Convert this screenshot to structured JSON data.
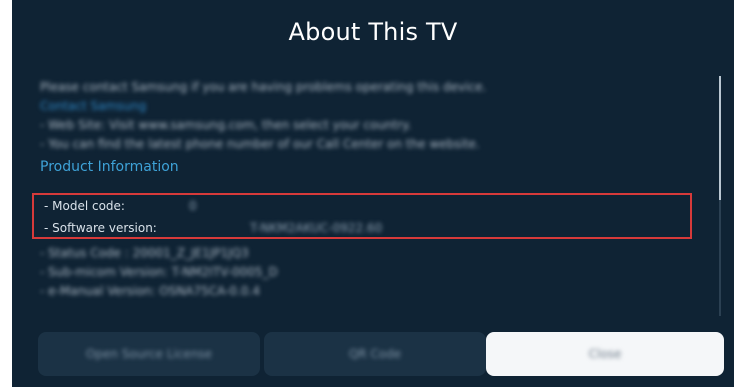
{
  "dialog": {
    "title": "About This TV"
  },
  "intro": {
    "contact_text": "Please contact Samsung if you are having problems operating this device.",
    "contact_link": "Contact Samsung",
    "website_line": " - Web Site: Visit www.samsung.com, then select your country.",
    "phone_line": " - You can find the latest phone number of our Call Center on the website."
  },
  "product_info": {
    "header": "Product Information",
    "model_label": " - Model code:",
    "model_value": "0",
    "software_label": " - Software version:",
    "software_value": "T-NKM2AKUC-0922.60"
  },
  "more_info": [
    " - Status Code : 20001_Z_JE1JP1JQ3",
    " - Sub-micom Version: T-NM2ITV-0005_D",
    " - e-Manual Version: OSNA75CA-0.0.4"
  ],
  "buttons": {
    "open_source": "Open Source License",
    "qr_code": "QR Code",
    "close": "Close"
  },
  "colors": {
    "background": "#0f2334",
    "section_header": "#3ea2d7",
    "highlight_border": "#d63a3a",
    "close_button": "#f5f7f9"
  }
}
